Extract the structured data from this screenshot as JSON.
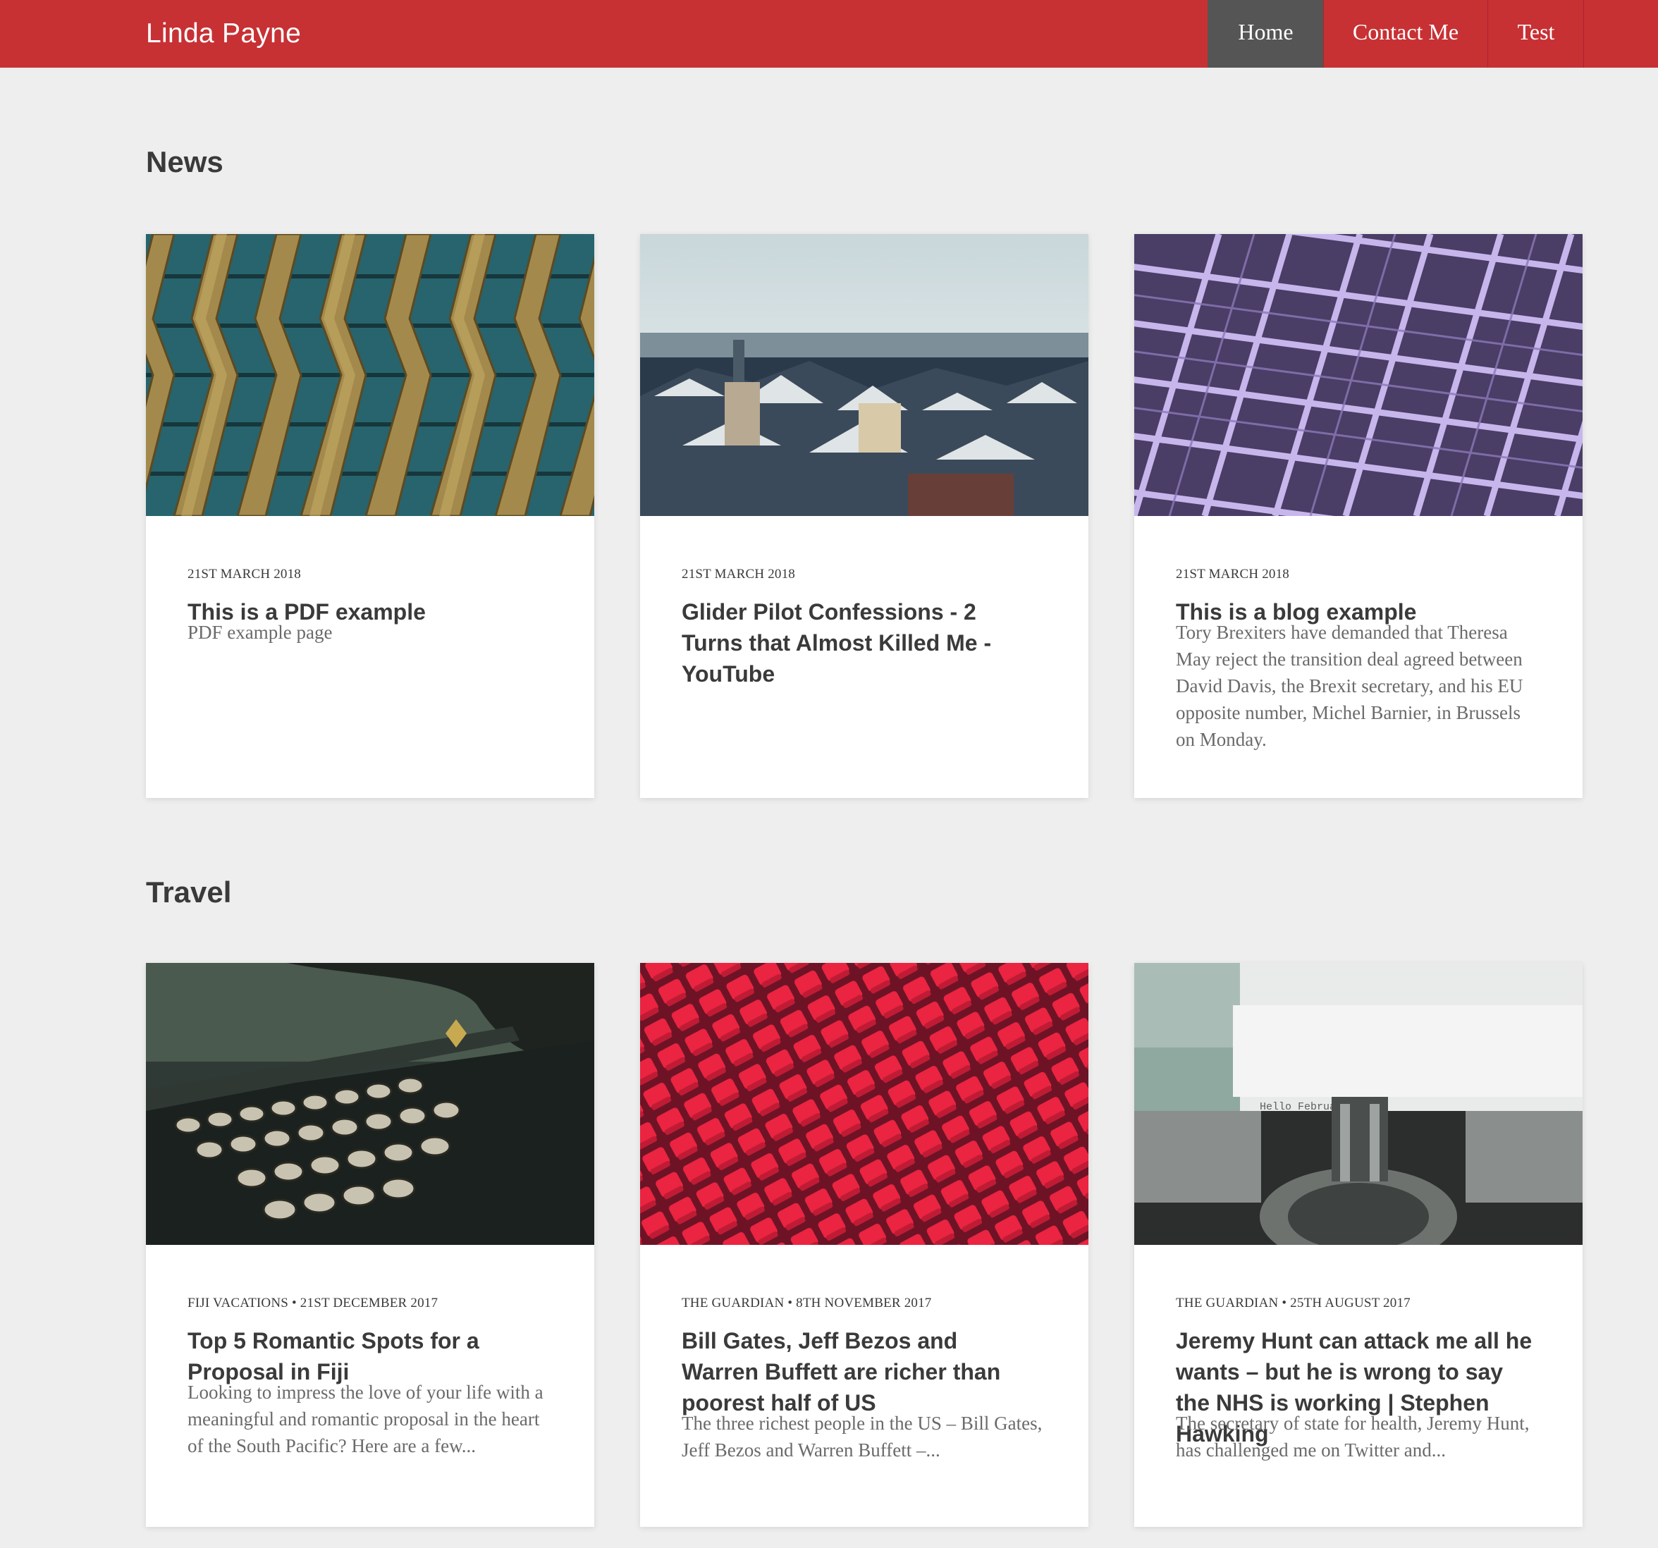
{
  "header": {
    "brand": "Linda Payne",
    "nav": [
      {
        "label": "Home",
        "active": true
      },
      {
        "label": "Contact Me",
        "active": false
      },
      {
        "label": "Test",
        "active": false
      }
    ]
  },
  "colors": {
    "header_bg": "#c73134",
    "nav_active_bg": "#555555",
    "page_bg": "#eeeeee",
    "card_bg": "#ffffff"
  },
  "sections": [
    {
      "title": "News",
      "cards": [
        {
          "image": "zigzag-architecture-image",
          "meta": "21st March 2018",
          "title": "This is a PDF example",
          "excerpt": "PDF example page"
        },
        {
          "image": "snowy-city-rooftops-image",
          "meta": "21st March 2018",
          "title": "Glider Pilot Confessions - 2 Turns that Almost Killed Me - YouTube",
          "excerpt": ""
        },
        {
          "image": "purple-lattice-roof-image",
          "meta": "21st March 2018",
          "title": "This is a blog example",
          "excerpt": "Tory Brexiters have demanded that Theresa May reject the transition deal agreed between David Davis, the Brexit secretary, and his EU opposite number, Michel Barnier, in Brussels on Monday."
        }
      ]
    },
    {
      "title": "Travel",
      "cards": [
        {
          "image": "vintage-typewriter-keys-image",
          "meta": "Fiji Vacations • 21st December 2017",
          "title": "Top 5 Romantic Spots for a Proposal in Fiji",
          "excerpt": "Looking to impress the love of your life with a meaningful and romantic proposal in the heart of the South Pacific? Here are a few..."
        },
        {
          "image": "red-stadium-seats-image",
          "meta": "The Guardian • 8th November 2017",
          "title": "Bill Gates, Jeff Bezos and Warren Buffett are richer than poorest half of US",
          "excerpt": "The three richest people in the US – Bill Gates, Jeff Bezos and Warren Buffett –..."
        },
        {
          "image": "typewriter-paper-image",
          "meta": "The Guardian • 25th August 2017",
          "title": "Jeremy Hunt can attack me all he wants – but he is wrong to say the NHS is working | Stephen Hawking",
          "excerpt": "The secretary of state for health, Jeremy Hunt, has challenged me on Twitter and...",
          "image_text": "Hello February 2016"
        }
      ]
    }
  ]
}
